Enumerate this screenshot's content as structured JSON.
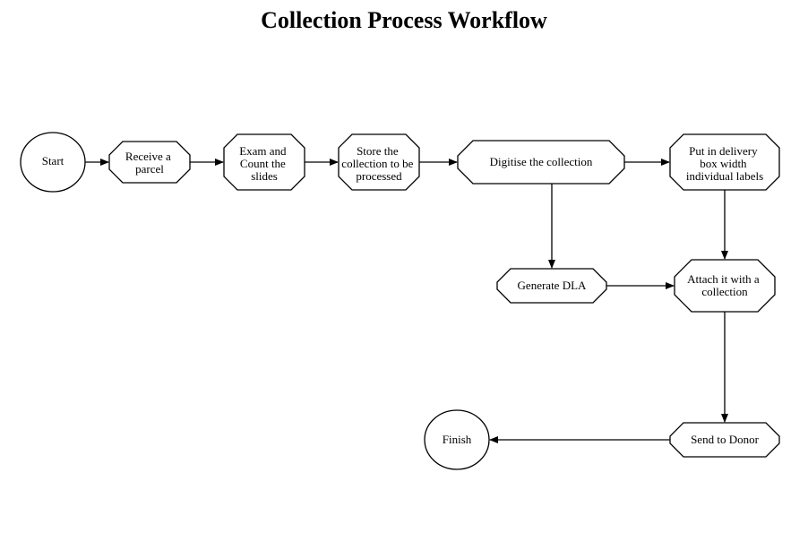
{
  "title": "Collection Process Workflow",
  "nodes": {
    "start": "Start",
    "receive": "Receive a parcel",
    "exam": "Exam and Count the slides",
    "store": "Store the collection to be processed",
    "digitise": "Digitise the collection",
    "deliverybox": "Put in delivery box width individual labels",
    "generate": "Generate DLA",
    "attach": "Attach it with a collection",
    "send": "Send to Donor",
    "finish": "Finish"
  },
  "edges": [
    {
      "from": "start",
      "to": "receive"
    },
    {
      "from": "receive",
      "to": "exam"
    },
    {
      "from": "exam",
      "to": "store"
    },
    {
      "from": "store",
      "to": "digitise"
    },
    {
      "from": "digitise",
      "to": "deliverybox"
    },
    {
      "from": "digitise",
      "to": "generate"
    },
    {
      "from": "deliverybox",
      "to": "attach"
    },
    {
      "from": "generate",
      "to": "attach"
    },
    {
      "from": "attach",
      "to": "send"
    },
    {
      "from": "send",
      "to": "finish"
    }
  ]
}
